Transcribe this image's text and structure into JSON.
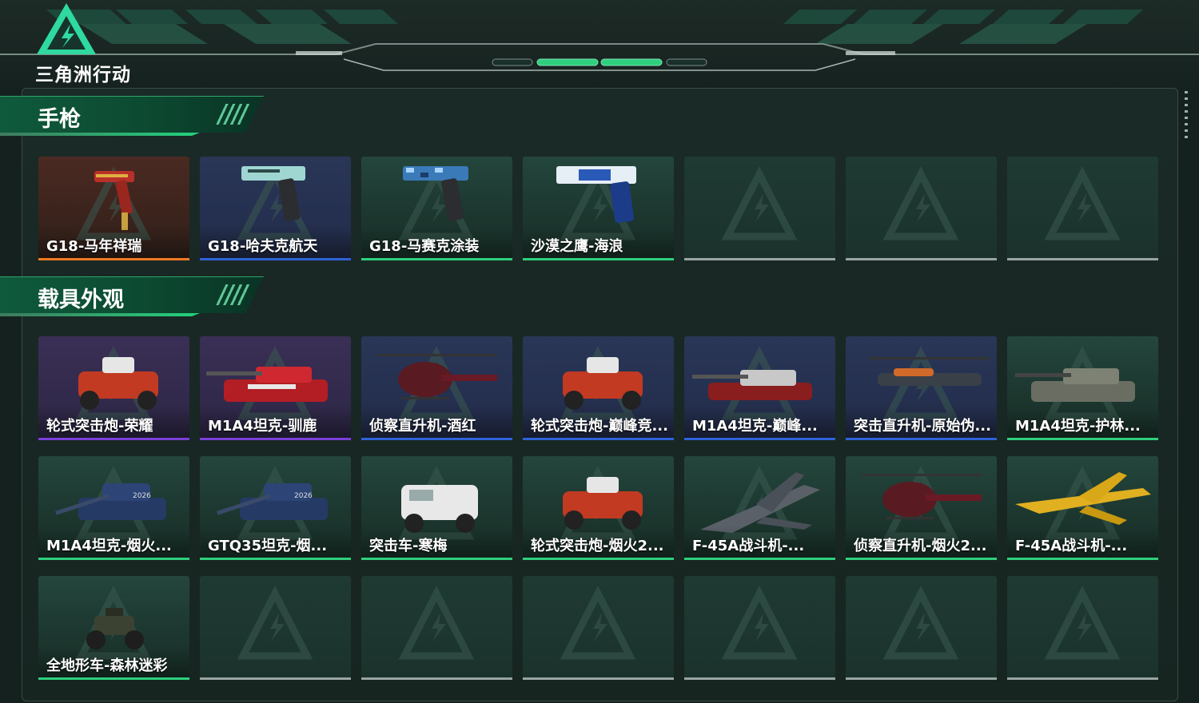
{
  "header": {
    "logo_text": "三角洲行动"
  },
  "colors": {
    "accent_green": "#2ecf7d",
    "rarity_orange": "#f07a22",
    "rarity_blue": "#2f62d8",
    "rarity_purple": "#7a3ed8",
    "empty_gray": "#98a5a1"
  },
  "sections": [
    {
      "title": "手枪",
      "rows": [
        [
          {
            "name": "G18-马年祥瑞",
            "rarity": "orange",
            "icon": "pistol-red-gold-skin"
          },
          {
            "name": "G18-哈夫克航天",
            "rarity": "blue",
            "icon": "pistol-haavk-aerospace-skin"
          },
          {
            "name": "G18-马赛克涂装",
            "rarity": "green",
            "icon": "pistol-mosaic-skin"
          },
          {
            "name": "沙漠之鹰-海浪",
            "rarity": "green",
            "icon": "desert-eagle-wave-skin"
          },
          {
            "name": "",
            "rarity": "empty"
          },
          {
            "name": "",
            "rarity": "empty"
          },
          {
            "name": "",
            "rarity": "empty"
          }
        ]
      ]
    },
    {
      "title": "载具外观",
      "rows": [
        [
          {
            "name": "轮式突击炮-荣耀",
            "rarity": "purple",
            "icon": "wheeled-assault-gun-icon"
          },
          {
            "name": "M1A4坦克-驯鹿",
            "rarity": "purple",
            "icon": "tank-reindeer-icon"
          },
          {
            "name": "侦察直升机-酒红",
            "rarity": "blue",
            "icon": "scout-helicopter-icon"
          },
          {
            "name": "轮式突击炮-巅峰竞...",
            "rarity": "blue",
            "icon": "wheeled-assault-gun-icon"
          },
          {
            "name": "M1A4坦克-巅峰...",
            "rarity": "blue",
            "icon": "tank-icon"
          },
          {
            "name": "突击直升机-原始伪...",
            "rarity": "blue",
            "icon": "attack-helicopter-icon"
          },
          {
            "name": "M1A4坦克-护林...",
            "rarity": "green",
            "icon": "tank-camo-icon"
          }
        ],
        [
          {
            "name": "M1A4坦克-烟火...",
            "rarity": "green",
            "icon": "tank-fireworks-icon"
          },
          {
            "name": "GTQ35坦克-烟...",
            "rarity": "green",
            "icon": "tank-fireworks-icon"
          },
          {
            "name": "突击车-寒梅",
            "rarity": "green",
            "icon": "assault-vehicle-icon"
          },
          {
            "name": "轮式突击炮-烟火2...",
            "rarity": "green",
            "icon": "wheeled-assault-gun-icon"
          },
          {
            "name": "F-45A战斗机-...",
            "rarity": "green",
            "icon": "fighter-jet-icon"
          },
          {
            "name": "侦察直升机-烟火2...",
            "rarity": "green",
            "icon": "scout-helicopter-icon"
          },
          {
            "name": "F-45A战斗机-...",
            "rarity": "green",
            "icon": "fighter-jet-yellow-icon"
          }
        ],
        [
          {
            "name": "全地形车-森林迷彩",
            "rarity": "green",
            "icon": "atv-icon"
          },
          {
            "name": "",
            "rarity": "empty"
          },
          {
            "name": "",
            "rarity": "empty"
          },
          {
            "name": "",
            "rarity": "empty"
          },
          {
            "name": "",
            "rarity": "empty"
          },
          {
            "name": "",
            "rarity": "empty"
          },
          {
            "name": "",
            "rarity": "empty"
          }
        ]
      ]
    }
  ]
}
